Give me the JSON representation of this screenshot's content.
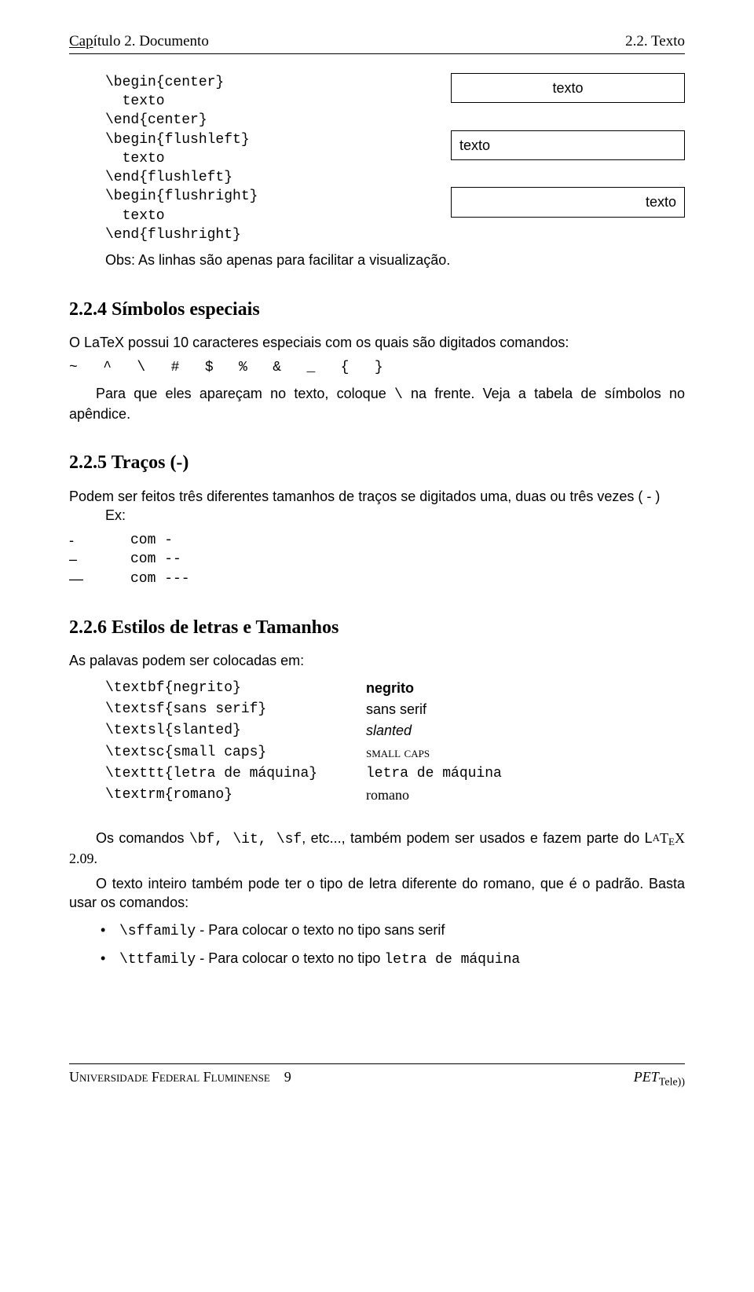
{
  "header": {
    "left_under": "Cap",
    "left_rest": "ítulo 2.  Documento",
    "right": "2.2.  Texto"
  },
  "env": {
    "center": {
      "begin": "\\begin{center}",
      "body": "  texto",
      "end": "\\end{center}",
      "demo": "texto"
    },
    "flushleft": {
      "begin": "\\begin{flushleft}",
      "body": "  texto",
      "end": "\\end{flushleft}",
      "demo": "texto"
    },
    "flushright": {
      "begin": "\\begin{flushright}",
      "body": "  texto",
      "end": "\\end{flushright}",
      "demo": "texto"
    }
  },
  "obs": "Obs: As linhas são apenas para facilitar a visualização.",
  "s224": {
    "heading": "2.2.4    Símbolos especiais",
    "p1": "O LaTeX possui 10 caracteres especiais com os quais são digitados comandos:",
    "chars": "~   ^   \\   #   $   %   &   _   {   }",
    "p2a": "Para que eles apareçam no texto, coloque ",
    "p2b": "\\",
    "p2c": " na frente. Veja a tabela de símbolos no apêndice."
  },
  "s225": {
    "heading": "2.2.5    Traços (-)",
    "intro": "Podem ser feitos três diferentes tamanhos de traços se digitados uma, duas ou três vezes ( - )",
    "ex": "Ex:",
    "rows": [
      {
        "out": "-",
        "in": "com -"
      },
      {
        "out": "–",
        "in": "com --"
      },
      {
        "out": "—",
        "in": "com ---"
      }
    ]
  },
  "s226": {
    "heading": "2.2.6    Estilos de letras e Tamanhos",
    "intro": "As palavas podem ser colocadas em:",
    "rows": [
      {
        "cmd": "\\textbf{negrito}",
        "out": "negrito",
        "cls": "bold"
      },
      {
        "cmd": "\\textsf{sans serif}",
        "out": "sans serif",
        "cls": "sans"
      },
      {
        "cmd": "\\textsl{slanted}",
        "out": "slanted",
        "cls": "sl"
      },
      {
        "cmd": "\\textsc{small caps}",
        "out": "small caps",
        "cls": "sc"
      },
      {
        "cmd": "\\texttt{letra de máquina}",
        "out": "letra de máquina",
        "cls": "tt"
      },
      {
        "cmd": "\\textrm{romano}",
        "out": "romano",
        "cls": "rm"
      }
    ],
    "p1a": "Os comandos ",
    "p1b": "\\bf, \\it, \\sf",
    "p1c": ", etc..., também podem ser usados e fazem parte do L",
    "p1d": "T",
    "p1e": "X 2.09.",
    "p2": "O texto inteiro também pode ter o tipo de letra diferente do romano, que é o padrão. Basta usar os comandos:",
    "b1a": "\\sffamily",
    "b1b": " - Para colocar o texto no tipo sans serif",
    "b2a": "\\ttfamily",
    "b2b": " - Para colocar o texto no tipo ",
    "b2c": "letra de máquina"
  },
  "footer": {
    "left": "Universidade Federal Fluminense",
    "page": "9",
    "right_pet": "PET",
    "right_tele": "Tele))"
  }
}
